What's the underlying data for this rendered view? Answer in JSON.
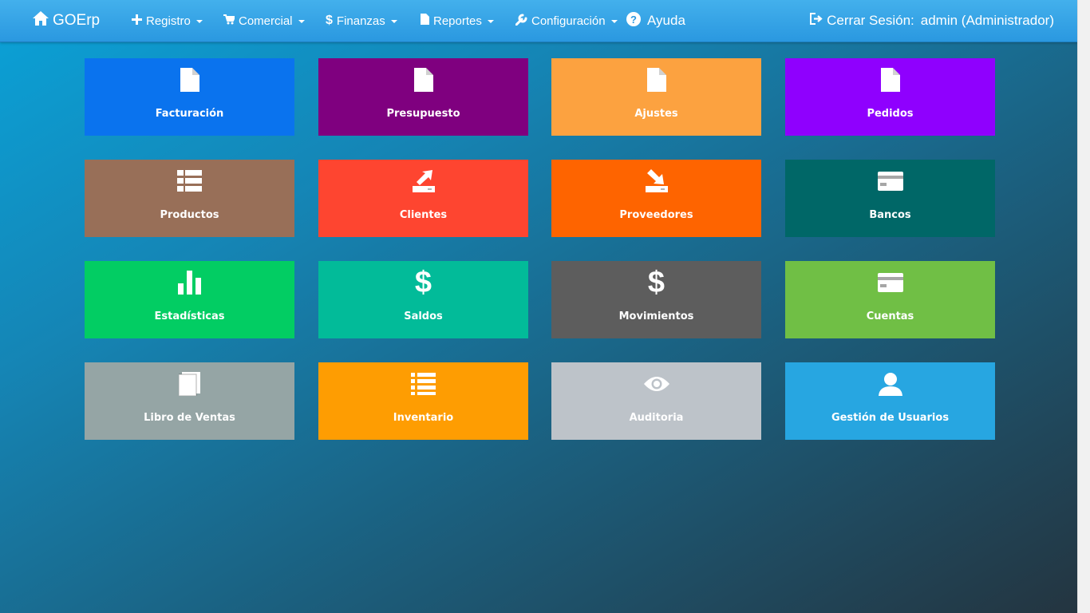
{
  "navbar": {
    "brand": "GOErp",
    "menus": [
      {
        "label": "Registro",
        "icon": "plus-icon"
      },
      {
        "label": "Comercial",
        "icon": "cart-icon"
      },
      {
        "label": "Finanzas",
        "icon": "dollar-icon"
      },
      {
        "label": "Reportes",
        "icon": "file-icon"
      },
      {
        "label": "Configuración",
        "icon": "wrench-icon"
      }
    ],
    "help": "Ayuda",
    "logout": "Cerrar Sesión:",
    "user": "admin (Administrador)"
  },
  "tiles": [
    {
      "label": "Facturación",
      "color": "#0a73ee",
      "icon": "file-icon"
    },
    {
      "label": "Presupuesto",
      "color": "#7f007f",
      "icon": "file-icon"
    },
    {
      "label": "Ajustes",
      "color": "#fca240",
      "icon": "file-icon"
    },
    {
      "label": "Pedidos",
      "color": "#8f00fe",
      "icon": "file-icon"
    },
    {
      "label": "Productos",
      "color": "#986f58",
      "icon": "list-icon"
    },
    {
      "label": "Clientes",
      "color": "#fe4530",
      "icon": "export-icon"
    },
    {
      "label": "Proveedores",
      "color": "#fe6400",
      "icon": "import-icon"
    },
    {
      "label": "Bancos",
      "color": "#006767",
      "icon": "card-icon"
    },
    {
      "label": "Estadísticas",
      "color": "#02cd63",
      "icon": "bar-chart-icon"
    },
    {
      "label": "Saldos",
      "color": "#02bb99",
      "icon": "dollar-icon"
    },
    {
      "label": "Movimientos",
      "color": "#5d5d5d",
      "icon": "dollar-icon"
    },
    {
      "label": "Cuentas",
      "color": "#70bf45",
      "icon": "card-icon"
    },
    {
      "label": "Libro de Ventas",
      "color": "#95a5a5",
      "icon": "book-icon"
    },
    {
      "label": "Inventario",
      "color": "#fe9d02",
      "icon": "list-bullets-icon"
    },
    {
      "label": "Auditoria",
      "color": "#bdc3c9",
      "icon": "eye-icon"
    },
    {
      "label": "Gestión de Usuarios",
      "color": "#27a6e1",
      "icon": "user-icon"
    }
  ]
}
